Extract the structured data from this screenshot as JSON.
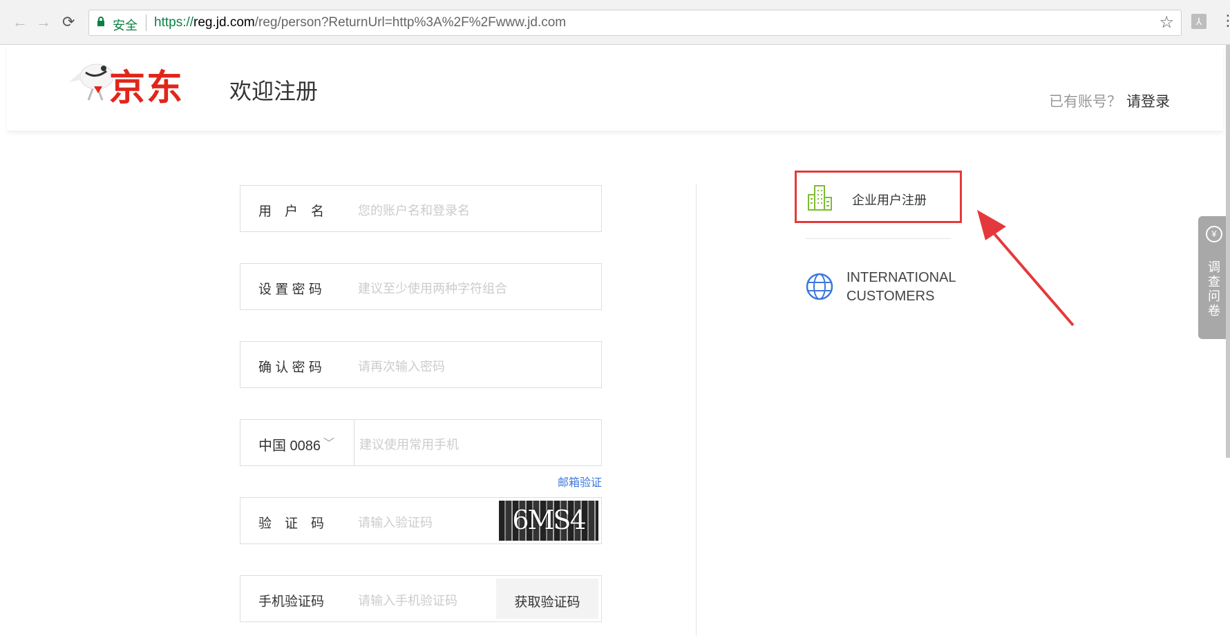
{
  "browser": {
    "secure_label": "安全",
    "url_scheme": "https://",
    "url_host": "reg.jd.com",
    "url_rest": "/reg/person?ReturnUrl=http%3A%2F%2Fwww.jd.com"
  },
  "header": {
    "logo_text": "京东",
    "welcome": "欢迎注册",
    "has_account": "已有账号？",
    "login_link": "请登录"
  },
  "form": {
    "username": {
      "label": "用　户　名",
      "placeholder": "您的账户名和登录名"
    },
    "password": {
      "label": "设 置 密 码",
      "placeholder": "建议至少使用两种字符组合"
    },
    "confirm": {
      "label": "确 认 密 码",
      "placeholder": "请再次输入密码"
    },
    "phone": {
      "country": "中国 0086",
      "placeholder": "建议使用常用手机"
    },
    "email_verify_link": "邮箱验证",
    "captcha": {
      "label": "验　证　码",
      "placeholder": "请输入验证码",
      "image_text": "6MS4"
    },
    "sms": {
      "label": "手机验证码",
      "placeholder": "请输入手机验证码",
      "button": "获取验证码"
    }
  },
  "side": {
    "enterprise": "企业用户注册",
    "international_line1": "INTERNATIONAL",
    "international_line2": "CUSTOMERS"
  },
  "survey": {
    "label": "调查问卷"
  },
  "colors": {
    "brand_red": "#e1251b",
    "link_blue": "#3b78dd",
    "secure_green": "#0b8043",
    "highlight_red": "#e4393c"
  }
}
